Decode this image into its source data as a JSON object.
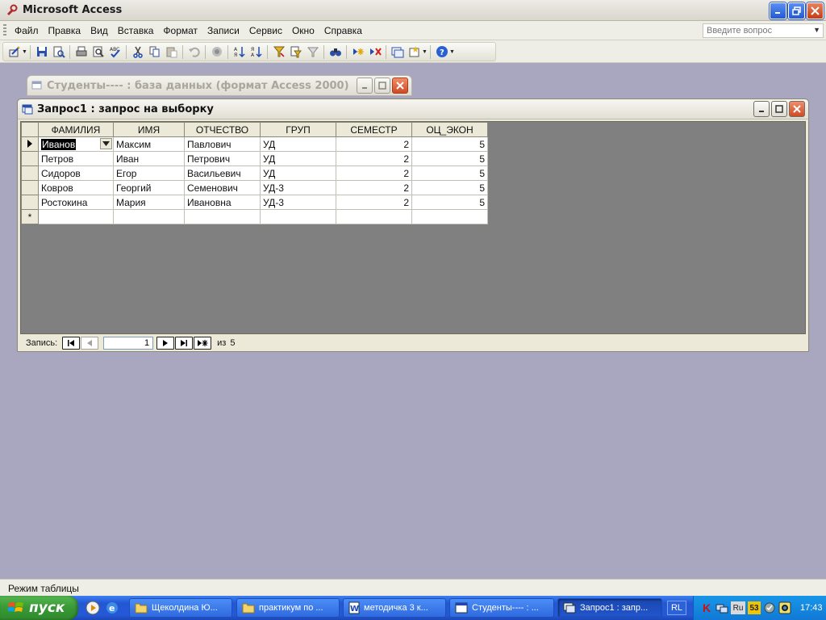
{
  "app": {
    "title": "Microsoft Access"
  },
  "menu": [
    {
      "label": "Файл",
      "name": "menu-file"
    },
    {
      "label": "Правка",
      "name": "menu-edit"
    },
    {
      "label": "Вид",
      "name": "menu-view"
    },
    {
      "label": "Вставка",
      "name": "menu-insert"
    },
    {
      "label": "Формат",
      "name": "menu-format"
    },
    {
      "label": "Записи",
      "name": "menu-records"
    },
    {
      "label": "Сервис",
      "name": "menu-tools"
    },
    {
      "label": "Окно",
      "name": "menu-window"
    },
    {
      "label": "Справка",
      "name": "menu-help"
    }
  ],
  "help_box": {
    "placeholder": "Введите вопрос"
  },
  "db_window": {
    "title": "Студенты---- : база данных (формат Access 2000)"
  },
  "query_window": {
    "title": "Запрос1 : запрос на выборку",
    "columns": [
      "ФАМИЛИЯ",
      "ИМЯ",
      "ОТЧЕСТВО",
      "ГРУП",
      "СЕМЕСТР",
      "ОЦ_ЭКОН"
    ],
    "rows": [
      [
        "Иванов",
        "Максим",
        "Павлович",
        "УД",
        "2",
        "5"
      ],
      [
        "Петров",
        "Иван",
        "Петрович",
        "УД",
        "2",
        "5"
      ],
      [
        "Сидоров",
        "Егор",
        "Васильевич",
        "УД",
        "2",
        "5"
      ],
      [
        "Ковров",
        "Георгий",
        "Семенович",
        "УД-3",
        "2",
        "5"
      ],
      [
        "Ростокина",
        "Мария",
        "Ивановна",
        "УД-3",
        "2",
        "5"
      ]
    ],
    "new_row_marker": "*"
  },
  "navigator": {
    "label": "Запись:",
    "current": "1",
    "of_label": "из",
    "total": "5"
  },
  "status": {
    "text": "Режим таблицы"
  },
  "taskbar": {
    "start_label": "пуск",
    "items": [
      {
        "label": "Щеколдина Ю...",
        "icon": "folder-icon"
      },
      {
        "label": "практикум по ...",
        "icon": "folder-icon"
      },
      {
        "label": "методичка 3 к...",
        "icon": "word-icon"
      },
      {
        "label": "Студенты---- : ...",
        "icon": "database-icon"
      },
      {
        "label": "Запрос1 : запр...",
        "icon": "query-icon"
      }
    ],
    "language": "RL",
    "tray_ru": "Ru",
    "tray_num": "53",
    "clock": "17:43"
  },
  "colors": {
    "taskbar_blue": "#2458d6",
    "start_green": "#3a9a37",
    "mdi_background": "#a9a6bf",
    "datasheet_empty": "#808080"
  }
}
